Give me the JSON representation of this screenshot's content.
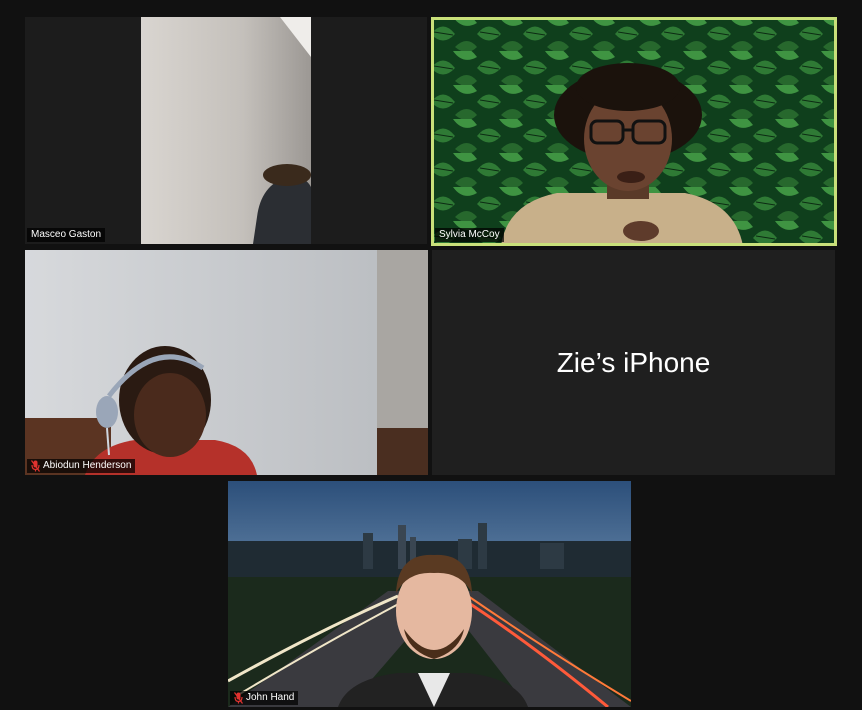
{
  "participants": [
    {
      "name": "Masceo Gaston",
      "muted": false,
      "video": true
    },
    {
      "name": "Sylvia McCoy",
      "muted": false,
      "video": true,
      "active_speaker": true
    },
    {
      "name": "Abiodun Henderson",
      "muted": true,
      "video": true
    },
    {
      "name": "Zie’s iPhone",
      "muted": false,
      "video": false
    },
    {
      "name": "John Hand",
      "muted": true,
      "video": true
    }
  ],
  "colors": {
    "background": "#111111",
    "tile_dark": "#1f1f1f",
    "active_speaker_border": "#c9e07a",
    "muted_icon": "#e0322f"
  },
  "icons": {
    "muted": "microphone-muted-icon"
  }
}
